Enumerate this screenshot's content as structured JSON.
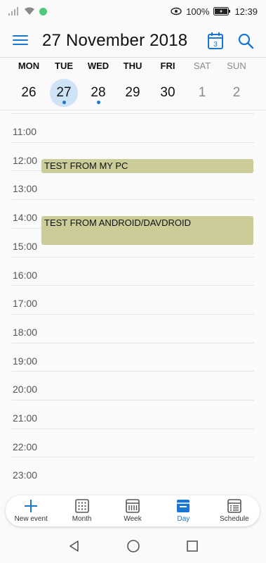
{
  "status": {
    "battery_percent": "100%",
    "time": "12:39"
  },
  "header": {
    "title": "27 November 2018",
    "today_badge": "3"
  },
  "week": {
    "days": [
      {
        "dow": "MON",
        "num": "26",
        "weekend": false,
        "selected": false,
        "has_events": false
      },
      {
        "dow": "TUE",
        "num": "27",
        "weekend": false,
        "selected": true,
        "has_events": true
      },
      {
        "dow": "WED",
        "num": "28",
        "weekend": false,
        "selected": false,
        "has_events": true
      },
      {
        "dow": "THU",
        "num": "29",
        "weekend": false,
        "selected": false,
        "has_events": false
      },
      {
        "dow": "FRI",
        "num": "30",
        "weekend": false,
        "selected": false,
        "has_events": false
      },
      {
        "dow": "SAT",
        "num": "1",
        "weekend": true,
        "selected": false,
        "has_events": false
      },
      {
        "dow": "SUN",
        "num": "2",
        "weekend": true,
        "selected": false,
        "has_events": false
      }
    ]
  },
  "timeline": {
    "hours": [
      "11:00",
      "12:00",
      "13:00",
      "14:00",
      "15:00",
      "16:00",
      "17:00",
      "18:00",
      "19:00",
      "20:00",
      "21:00",
      "22:00",
      "23:00"
    ],
    "first_hour": 11,
    "events": [
      {
        "title": "TEST FROM MY PC",
        "start": 12.0,
        "end": 12.5
      },
      {
        "title": "TEST FROM ANDROID/DAVDROID",
        "start": 14.0,
        "end": 15.0
      }
    ],
    "event_color": "#cccc99"
  },
  "bottom_nav": {
    "items": [
      {
        "label": "New event",
        "icon": "plus-icon",
        "active": false
      },
      {
        "label": "Month",
        "icon": "month-grid-icon",
        "active": false
      },
      {
        "label": "Week",
        "icon": "week-view-icon",
        "active": false
      },
      {
        "label": "Day",
        "icon": "day-view-icon",
        "active": true
      },
      {
        "label": "Schedule",
        "icon": "schedule-list-icon",
        "active": false
      }
    ]
  },
  "colors": {
    "accent": "#1976d2",
    "selected_day_bg": "#cfe3f7",
    "weekend_text": "#8a8a8a"
  }
}
